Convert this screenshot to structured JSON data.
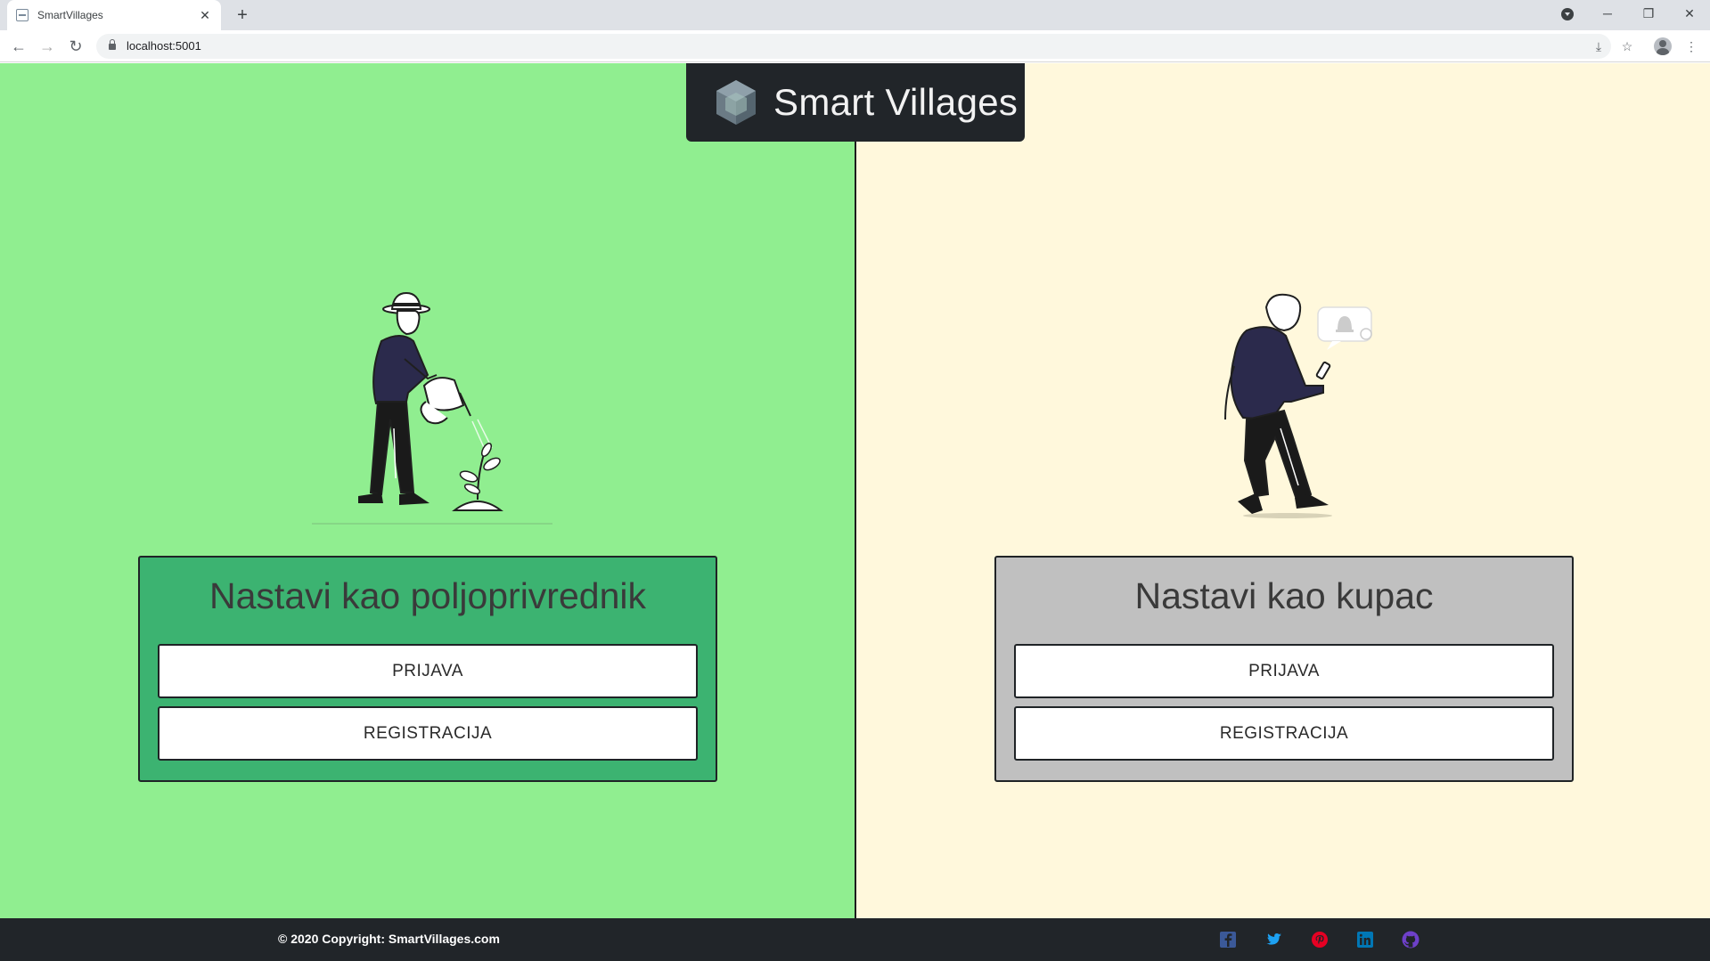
{
  "browser": {
    "tab_title": "SmartVillages",
    "tab_close": "✕",
    "new_tab": "+",
    "url": "localhost:5001",
    "window_minimize": "─",
    "window_restore": "❐",
    "window_close": "✕"
  },
  "header": {
    "brand_name": "Smart Villages"
  },
  "farmer": {
    "title": "Nastavi kao poljoprivrednik",
    "login_label": "PRIJAVA",
    "register_label": "REGISTRACIJA",
    "panel_color": "#90ee90",
    "card_color": "#3cb371"
  },
  "buyer": {
    "title": "Nastavi kao kupac",
    "login_label": "PRIJAVA",
    "register_label": "REGISTRACIJA",
    "panel_color": "#fff8dc",
    "card_color": "#c0c0c0"
  },
  "footer": {
    "copyright": "© 2020 Copyright: SmartVillages.com",
    "social_icons": [
      "facebook-icon",
      "twitter-icon",
      "pinterest-icon",
      "linkedin-icon",
      "github-icon"
    ],
    "social_colors": [
      "#3b5998",
      "#1da1f2",
      "#e60023",
      "#0077b5",
      "#6e40c9"
    ]
  }
}
